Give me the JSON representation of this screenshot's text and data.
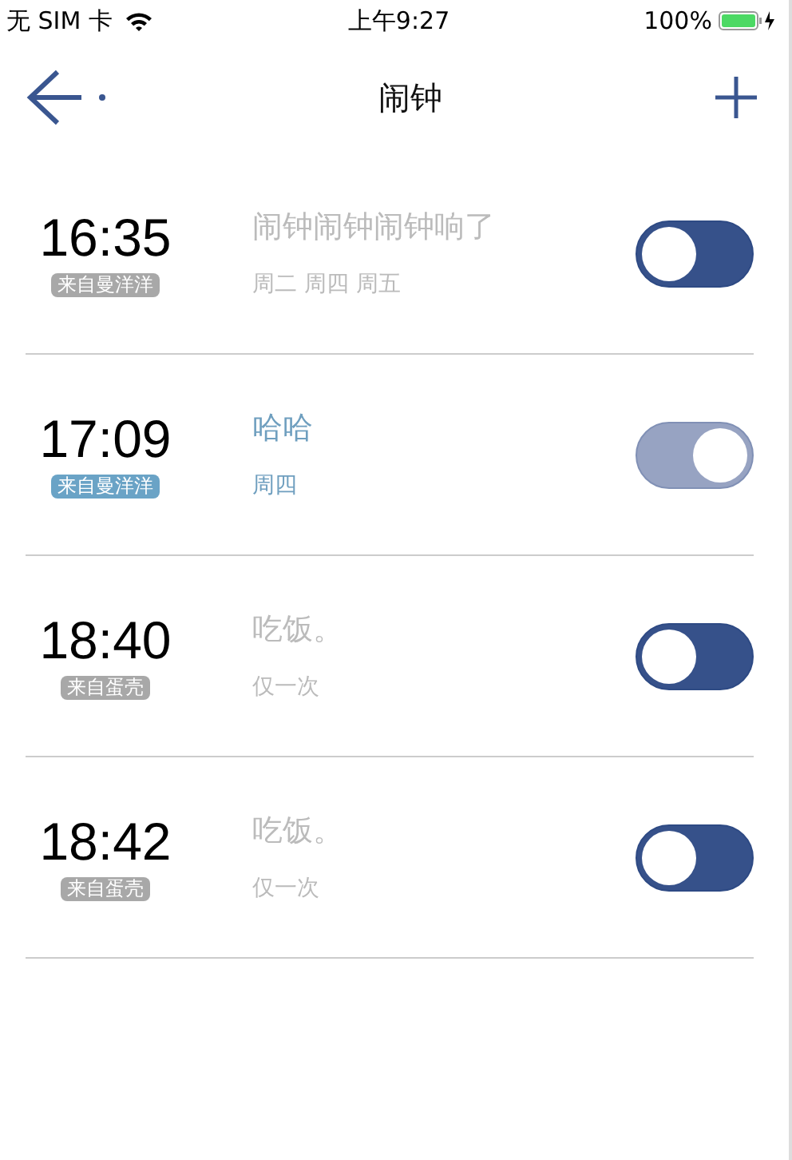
{
  "status_bar": {
    "carrier": "无 SIM 卡",
    "time": "上午9:27",
    "battery": "100%"
  },
  "nav": {
    "title": "闹钟"
  },
  "alarms": [
    {
      "time": "16:35",
      "source": "来自曼洋洋",
      "label": "闹钟闹钟闹钟响了",
      "repeat": "周二 周四 周五",
      "on": false
    },
    {
      "time": "17:09",
      "source": "来自曼洋洋",
      "label": "哈哈",
      "repeat": "周四",
      "on": true
    },
    {
      "time": "18:40",
      "source": "来自蛋壳",
      "label": "吃饭。",
      "repeat": "仅一次",
      "on": false
    },
    {
      "time": "18:42",
      "source": "来自蛋壳",
      "label": "吃饭。",
      "repeat": "仅一次",
      "on": false
    }
  ]
}
